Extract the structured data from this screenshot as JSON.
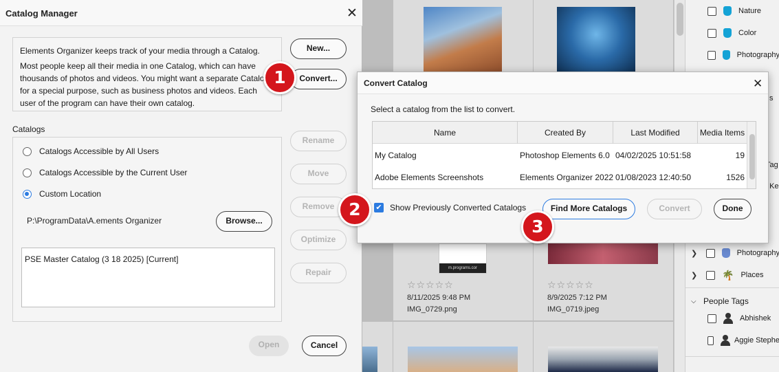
{
  "catalog_manager": {
    "title": "Catalog Manager",
    "description_1": "Elements Organizer keeps track of your media through a Catalog.",
    "description_2": "Most people keep all their media in one Catalog, which can have thousands of photos and videos. You might want a separate Catalog for a special purpose, such as business photos and videos. Each user of the program can have their own catalog.",
    "buttons": {
      "new": "New...",
      "convert": "Convert...",
      "rename": "Rename",
      "move": "Move",
      "remove": "Remove",
      "optimize": "Optimize",
      "repair": "Repair",
      "browse": "Browse...",
      "open": "Open",
      "cancel": "Cancel"
    },
    "catalogs_label": "Catalogs",
    "radio_options": [
      {
        "label": "Catalogs Accessible by All Users",
        "selected": false
      },
      {
        "label": "Catalogs Accessible by the Current User",
        "selected": false
      },
      {
        "label": "Custom Location",
        "selected": true
      }
    ],
    "custom_path": "P:\\ProgramData\\A.ements Organizer",
    "catalog_list": [
      "PSE Master Catalog (3 18 2025) [Current]"
    ]
  },
  "convert_catalog": {
    "title": "Convert Catalog",
    "instruction": "Select a catalog from the list to convert.",
    "columns": [
      "Name",
      "Created By",
      "Last Modified",
      "Media Items"
    ],
    "rows": [
      {
        "name": "My Catalog",
        "created_by": "Photoshop Elements 6.0",
        "last_modified": "04/02/2025 10:51:58",
        "media_items": "19"
      },
      {
        "name": "Adobe Elements Screenshots",
        "created_by": "Elements Organizer 2022",
        "last_modified": "01/08/2023 12:40:50",
        "media_items": "1526"
      }
    ],
    "show_converted_label": "Show Previously Converted Catalogs",
    "show_converted_checked": true,
    "buttons": {
      "find_more": "Find More Catalogs",
      "convert": "Convert",
      "done": "Done"
    }
  },
  "callouts": [
    "1",
    "2",
    "3"
  ],
  "media_grid": {
    "items": [
      {
        "stars": "☆☆☆☆☆",
        "date": "8/11/2025 9:48 PM",
        "filename": "IMG_0729.png"
      },
      {
        "stars": "☆☆☆☆☆",
        "date": "8/9/2025 7:12 PM",
        "filename": "IMG_0719.jpeg"
      }
    ],
    "phone_caption": "m.programs.cor"
  },
  "tag_panel": {
    "tags": [
      "Nature",
      "Color",
      "Photography"
    ],
    "partial_labels": [
      "s",
      "Tag",
      "d Ke"
    ],
    "lower_tags": [
      "Photography",
      "Places"
    ],
    "people_section": "People Tags",
    "people": [
      "Abhishek",
      "Aggie Stephe"
    ]
  },
  "colors": {
    "accent_blue": "#2c7be0",
    "callout_red": "#d4161c",
    "tag_cyan": "#14a3d6"
  }
}
